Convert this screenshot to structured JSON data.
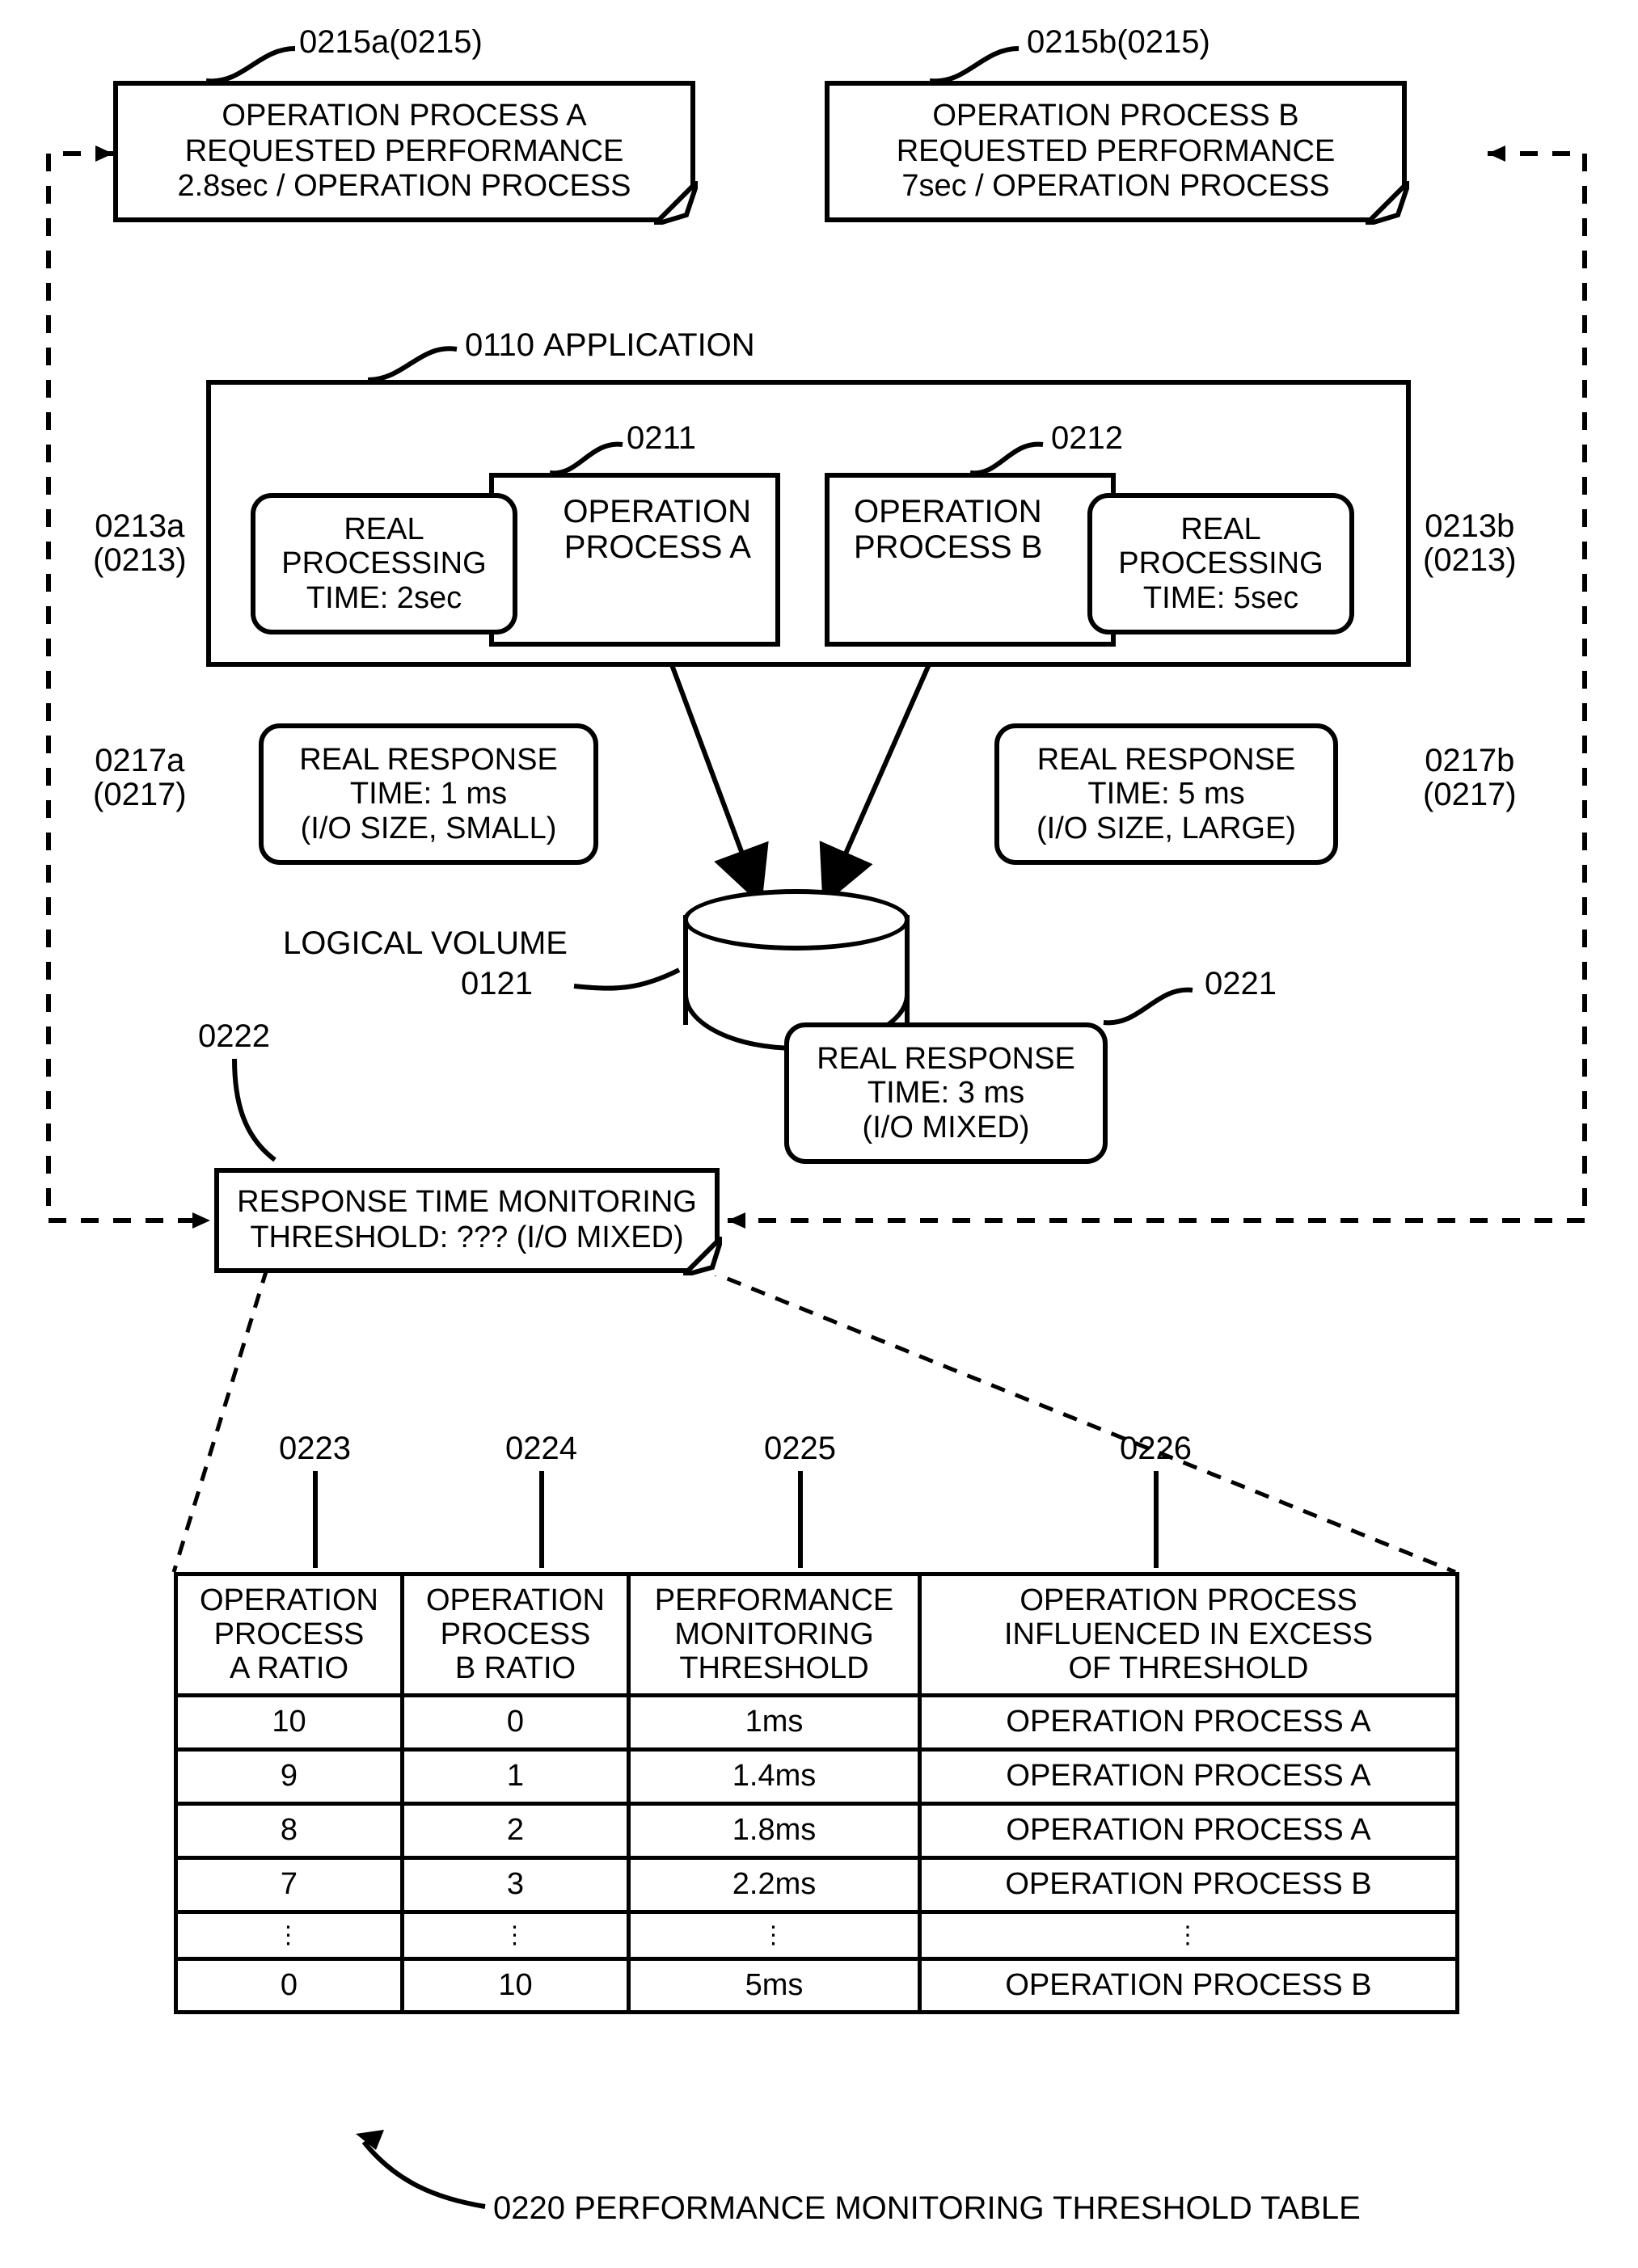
{
  "refs": {
    "r0215a": "0215a(0215)",
    "r0215b": "0215b(0215)",
    "r0110": "0110",
    "r0110_label": "APPLICATION",
    "r0211": "0211",
    "r0212": "0212",
    "r0213a_top": "0213a",
    "r0213a_bot": "(0213)",
    "r0213b_top": "0213b",
    "r0213b_bot": "(0213)",
    "r0217a_top": "0217a",
    "r0217a_bot": "(0217)",
    "r0217b_top": "0217b",
    "r0217b_bot": "(0217)",
    "r0121": "0121",
    "r0121_label": "LOGICAL VOLUME",
    "r0221": "0221",
    "r0222": "0222",
    "r0223": "0223",
    "r0224": "0224",
    "r0225": "0225",
    "r0226": "0226",
    "r0220": "0220",
    "r0220_label": "PERFORMANCE MONITORING THRESHOLD TABLE"
  },
  "notes": {
    "n0215a": {
      "l1": "OPERATION PROCESS A",
      "l2": "REQUESTED PERFORMANCE",
      "l3": "2.8sec / OPERATION PROCESS"
    },
    "n0215b": {
      "l1": "OPERATION PROCESS B",
      "l2": "REQUESTED PERFORMANCE",
      "l3": "7sec / OPERATION PROCESS"
    },
    "n0222": {
      "l1": "RESPONSE TIME MONITORING",
      "l2": "THRESHOLD: ??? (I/O MIXED)"
    }
  },
  "boxes": {
    "opA": {
      "l1": "OPERATION",
      "l2": "PROCESS A"
    },
    "opB": {
      "l1": "OPERATION",
      "l2": "PROCESS B"
    },
    "rt_a": {
      "l1": "REAL",
      "l2": "PROCESSING",
      "l3": "TIME: 2sec"
    },
    "rt_b": {
      "l1": "REAL",
      "l2": "PROCESSING",
      "l3": "TIME: 5sec"
    },
    "resp_a": {
      "l1": "REAL RESPONSE",
      "l2": "TIME: 1 ms",
      "l3": "(I/O SIZE, SMALL)"
    },
    "resp_b": {
      "l1": "REAL RESPONSE",
      "l2": "TIME: 5 ms",
      "l3": "(I/O SIZE, LARGE)"
    },
    "resp_mix": {
      "l1": "REAL RESPONSE",
      "l2": "TIME: 3 ms",
      "l3": "(I/O MIXED)"
    }
  },
  "table": {
    "headers": {
      "c1a": "OPERATION",
      "c1b": "PROCESS",
      "c1c": "A RATIO",
      "c2a": "OPERATION",
      "c2b": "PROCESS",
      "c2c": "B RATIO",
      "c3a": "PERFORMANCE",
      "c3b": "MONITORING",
      "c3c": "THRESHOLD",
      "c4a": "OPERATION PROCESS",
      "c4b": "INFLUENCED IN EXCESS",
      "c4c": "OF THRESHOLD"
    },
    "rows": [
      {
        "a": "10",
        "b": "0",
        "c": "1ms",
        "d": "OPERATION PROCESS A"
      },
      {
        "a": "9",
        "b": "1",
        "c": "1.4ms",
        "d": "OPERATION PROCESS A"
      },
      {
        "a": "8",
        "b": "2",
        "c": "1.8ms",
        "d": "OPERATION PROCESS A"
      },
      {
        "a": "7",
        "b": "3",
        "c": "2.2ms",
        "d": "OPERATION PROCESS B"
      },
      {
        "a": "⋮",
        "b": "⋮",
        "c": "⋮",
        "d": "⋮"
      },
      {
        "a": "0",
        "b": "10",
        "c": "5ms",
        "d": "OPERATION PROCESS B"
      }
    ]
  },
  "chart_data": {
    "type": "table",
    "title": "PERFORMANCE MONITORING THRESHOLD TABLE",
    "columns": [
      "OPERATION PROCESS A RATIO",
      "OPERATION PROCESS B RATIO",
      "PERFORMANCE MONITORING THRESHOLD",
      "OPERATION PROCESS INFLUENCED IN EXCESS OF THRESHOLD"
    ],
    "rows": [
      [
        "10",
        "0",
        "1ms",
        "OPERATION PROCESS A"
      ],
      [
        "9",
        "1",
        "1.4ms",
        "OPERATION PROCESS A"
      ],
      [
        "8",
        "2",
        "1.8ms",
        "OPERATION PROCESS A"
      ],
      [
        "7",
        "3",
        "2.2ms",
        "OPERATION PROCESS B"
      ],
      [
        "0",
        "10",
        "5ms",
        "OPERATION PROCESS B"
      ]
    ],
    "note": "Rows between ratio 7:3 and 0:10 are elided with vertical dots in the figure."
  }
}
